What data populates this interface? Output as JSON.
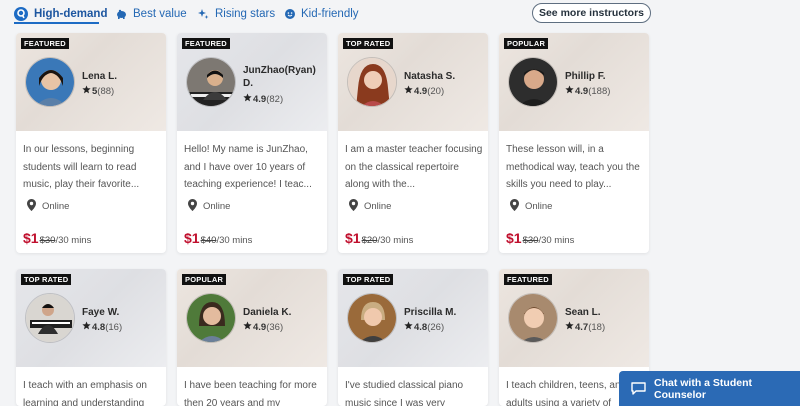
{
  "tabs": [
    {
      "label": "High-demand",
      "icon": "high-demand-icon",
      "active": true
    },
    {
      "label": "Best value",
      "icon": "piggy-bank-icon",
      "active": false
    },
    {
      "label": "Rising stars",
      "icon": "sparkle-icon",
      "active": false
    },
    {
      "label": "Kid-friendly",
      "icon": "smiley-icon",
      "active": false
    }
  ],
  "see_more_label": "See more instructors",
  "chat_label": "Chat with a Student Counselor",
  "colors": {
    "accent": "#2468b4",
    "price": "#c0102e",
    "chat_bg": "#2b6ab5"
  },
  "instructors": [
    {
      "badge": "FEATURED",
      "name": "Lena L.",
      "rating": "5",
      "reviews": "(88)",
      "description": "In our lessons, beginning students will learn to read music, play their favorite...",
      "location": "Online",
      "price": "$1",
      "old_price": "$30",
      "per": "/30 mins"
    },
    {
      "badge": "FEATURED",
      "name": "JunZhao(Ryan) D.",
      "rating": "4.9",
      "reviews": "(82)",
      "description": "Hello! My name is JunZhao, and I have over 10 years of teaching experience! I teac...",
      "location": "Online",
      "price": "$1",
      "old_price": "$40",
      "per": "/30 mins"
    },
    {
      "badge": "TOP RATED",
      "name": "Natasha S.",
      "rating": "4.9",
      "reviews": "(20)",
      "description": "I am a master teacher focusing on the classical repertoire along with the...",
      "location": "Online",
      "price": "$1",
      "old_price": "$20",
      "per": "/30 mins"
    },
    {
      "badge": "POPULAR",
      "name": "Phillip F.",
      "rating": "4.9",
      "reviews": "(188)",
      "description": "These lesson will, in a methodical way, teach you the skills you need to play...",
      "location": "Online",
      "price": "$1",
      "old_price": "$30",
      "per": "/30 mins"
    },
    {
      "badge": "TOP RATED",
      "name": "Faye W.",
      "rating": "4.8",
      "reviews": "(16)",
      "description": "I teach with an emphasis on learning and understanding"
    },
    {
      "badge": "POPULAR",
      "name": "Daniela K.",
      "rating": "4.9",
      "reviews": "(36)",
      "description": "I have been teaching for more then 20 years and my"
    },
    {
      "badge": "TOP RATED",
      "name": "Priscilla M.",
      "rating": "4.8",
      "reviews": "(26)",
      "description": "I've studied classical piano music since I was very"
    },
    {
      "badge": "FEATURED",
      "name": "Sean L.",
      "rating": "4.7",
      "reviews": "(18)",
      "description": "I teach children, teens, and adults using a variety of"
    }
  ]
}
